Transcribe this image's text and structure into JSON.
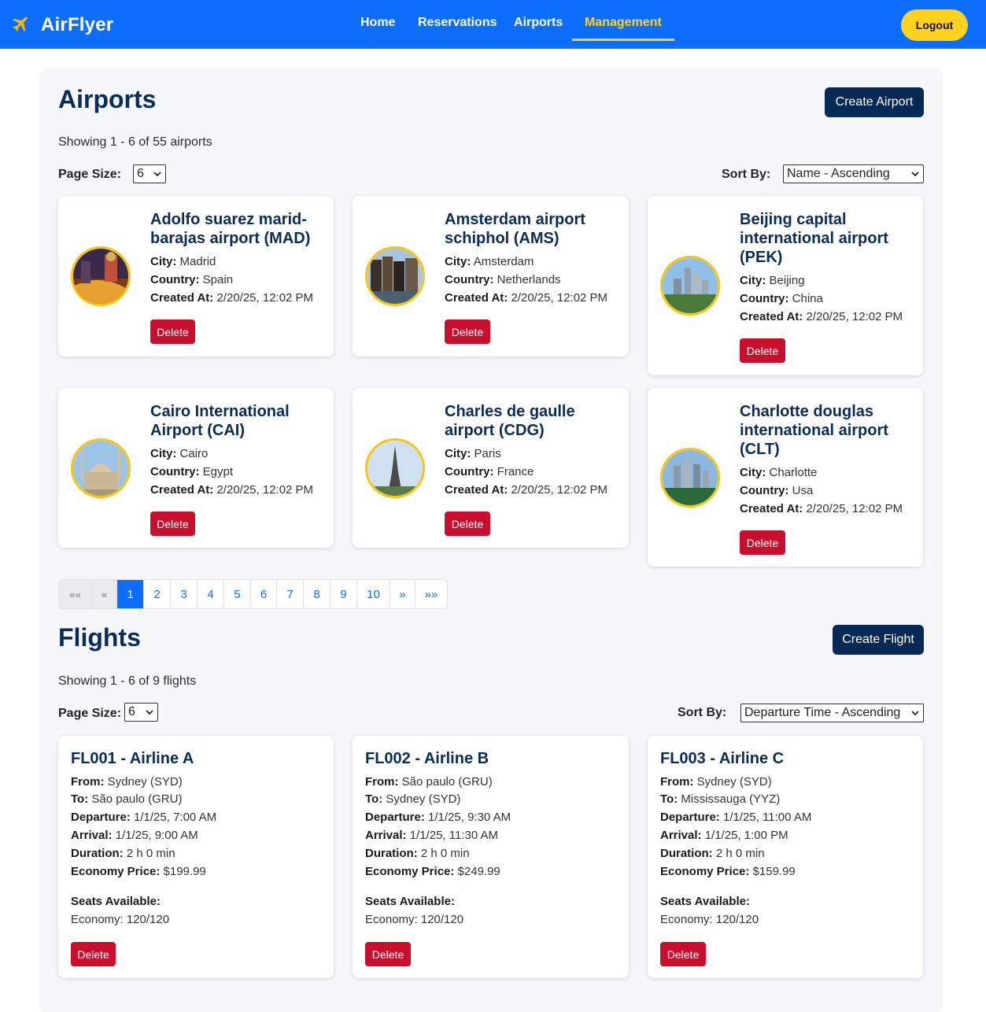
{
  "nav": {
    "brand": "AirFlyer",
    "links": [
      "Home",
      "Reservations",
      "Airports",
      "Management"
    ],
    "active": "Management",
    "logout": "Logout",
    "colors": {
      "bar": "#0d6efd",
      "accent": "#ffd21f"
    }
  },
  "airports": {
    "title": "Airports",
    "create_label": "Create Airport",
    "showing": "Showing 1 - 6 of 55 airports",
    "page_size_label": "Page Size:",
    "page_size_value": "6",
    "sort_label": "Sort By:",
    "sort_value": "Name - Ascending",
    "labels": {
      "city": "City:",
      "country": "Country:",
      "created": "Created At:"
    },
    "delete_label": "Delete",
    "items": [
      {
        "name": "Adolfo suarez marid-barajas airport (MAD)",
        "city": "Madrid",
        "country": "Spain",
        "created": "2/20/25, 12:02 PM",
        "image": "madrid-city-photo"
      },
      {
        "name": "Amsterdam airport schiphol (AMS)",
        "city": "Amsterdam",
        "country": "Netherlands",
        "created": "2/20/25, 12:02 PM",
        "image": "amsterdam-canal-houses-photo"
      },
      {
        "name": "Beijing capital international airport (PEK)",
        "city": "Beijing",
        "country": "China",
        "created": "2/20/25, 12:02 PM",
        "image": "beijing-skyline-photo"
      },
      {
        "name": "Cairo International Airport (CAI)",
        "city": "Cairo",
        "country": "Egypt",
        "created": "2/20/25, 12:02 PM",
        "image": "cairo-mosque-photo"
      },
      {
        "name": "Charles de gaulle airport (CDG)",
        "city": "Paris",
        "country": "France",
        "created": "2/20/25, 12:02 PM",
        "image": "paris-eiffel-tower-photo"
      },
      {
        "name": "Charlotte douglas international airport (CLT)",
        "city": "Charlotte",
        "country": "Usa",
        "created": "2/20/25, 12:02 PM",
        "image": "charlotte-skyline-photo"
      }
    ],
    "pagination": {
      "first": "««",
      "prev": "«",
      "pages": [
        "1",
        "2",
        "3",
        "4",
        "5",
        "6",
        "7",
        "8",
        "9",
        "10"
      ],
      "active": "1",
      "next": "»",
      "last": "»»"
    }
  },
  "flights": {
    "title": "Flights",
    "create_label": "Create Flight",
    "showing": "Showing 1 - 6 of 9 flights",
    "page_size_label": "Page Size:",
    "page_size_value": "6",
    "sort_label": "Sort By:",
    "sort_value": "Departure Time - Ascending",
    "labels": {
      "from": "From:",
      "to": "To:",
      "departure": "Departure:",
      "arrival": "Arrival:",
      "duration": "Duration:",
      "economy_price": "Economy Price:",
      "seats": "Seats Available:"
    },
    "delete_label": "Delete",
    "items": [
      {
        "title": "FL001 - Airline A",
        "from": "Sydney (SYD)",
        "to": "São paulo (GRU)",
        "departure": "1/1/25, 7:00 AM",
        "arrival": "1/1/25, 9:00 AM",
        "duration": "2 h 0 min",
        "economy_price": "$199.99",
        "economy_seats": "Economy: 120/120"
      },
      {
        "title": "FL002 - Airline B",
        "from": "São paulo (GRU)",
        "to": "Sydney (SYD)",
        "departure": "1/1/25, 9:30 AM",
        "arrival": "1/1/25, 11:30 AM",
        "duration": "2 h 0 min",
        "economy_price": "$249.99",
        "economy_seats": "Economy: 120/120"
      },
      {
        "title": "FL003 - Airline C",
        "from": "Sydney (SYD)",
        "to": "Mississauga (YYZ)",
        "departure": "1/1/25, 11:00 AM",
        "arrival": "1/1/25, 1:00 PM",
        "duration": "2 h 0 min",
        "economy_price": "$159.99",
        "economy_seats": "Economy: 120/120"
      }
    ]
  }
}
